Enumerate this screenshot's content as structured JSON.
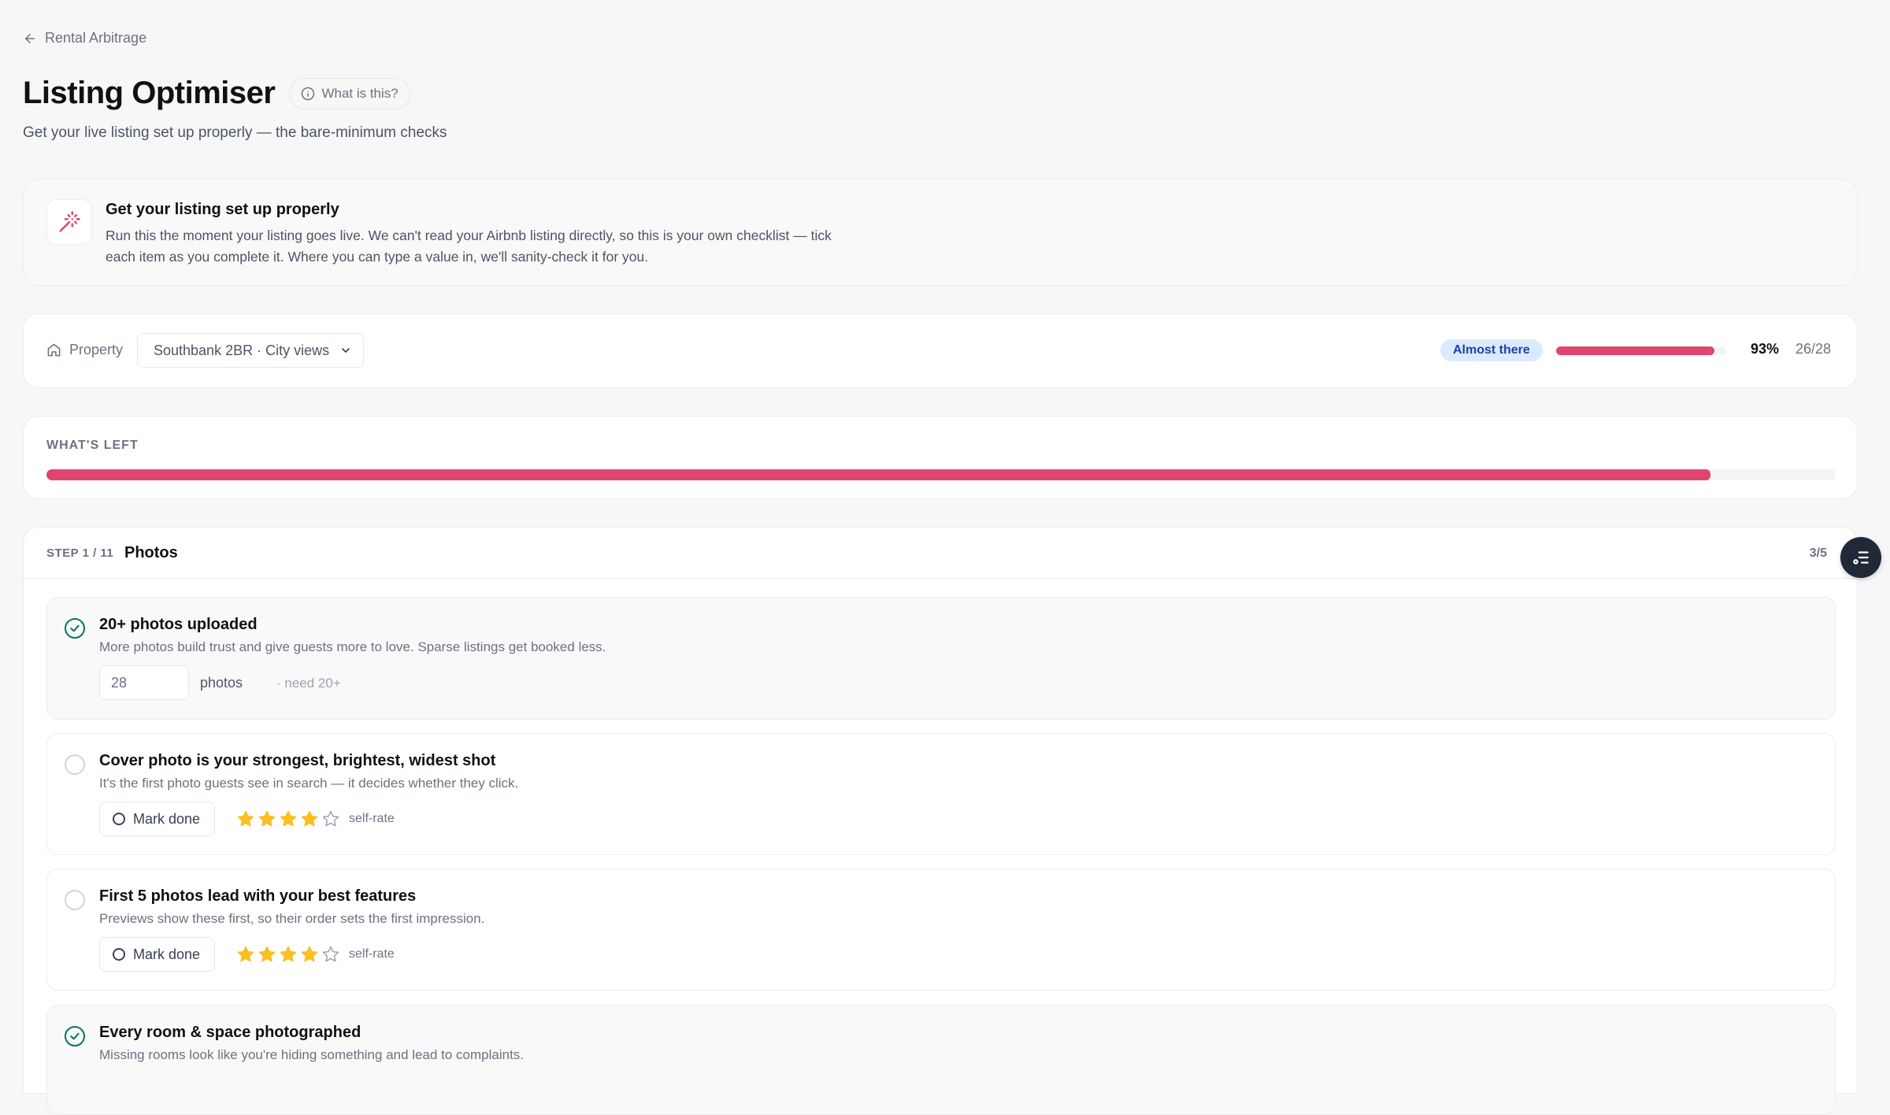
{
  "breadcrumb": {
    "label": "Rental Arbitrage"
  },
  "header": {
    "title": "Listing Optimiser",
    "help_label": "What is this?",
    "subtitle": "Get your live listing set up properly — the bare-minimum checks"
  },
  "intro": {
    "title": "Get your listing set up properly",
    "text": "Run this the moment your listing goes live. We can't read your Airbnb listing directly, so this is your own checklist — tick each item as you complete it. Where you can type a value in, we'll sanity-check it for you."
  },
  "property": {
    "label": "Property",
    "selected": "Southbank 2BR · City views",
    "status_badge": "Almost there",
    "progress_pct": 93,
    "percent_label": "93%",
    "count_label": "26/28"
  },
  "whats_left": {
    "label": "WHAT'S LEFT",
    "progress_pct": 93
  },
  "step": {
    "label": "STEP 1 / 11",
    "name": "Photos",
    "count": "3/5",
    "items": [
      {
        "title": "20+ photos uploaded",
        "desc": "More photos build trust and give guests more to love. Sparse listings get booked less.",
        "done": true,
        "input_value": "28",
        "unit": "photos",
        "need": "· need 20+"
      },
      {
        "title": "Cover photo is your strongest, brightest, widest shot",
        "desc": "It's the first photo guests see in search — it decides whether they click.",
        "done": false,
        "button_label": "Mark done",
        "rating": 4,
        "rating_max": 5,
        "rating_label": "self-rate"
      },
      {
        "title": "First 5 photos lead with your best features",
        "desc": "Previews show these first, so their order sets the first impression.",
        "done": false,
        "button_label": "Mark done",
        "rating": 4,
        "rating_max": 5,
        "rating_label": "self-rate"
      },
      {
        "title": "Every room & space photographed",
        "desc": "Missing rooms look like you're hiding something and lead to complaints.",
        "done": true
      }
    ]
  },
  "colors": {
    "accent": "#e0466d",
    "done_green": "#047857",
    "star": "#fbbf24",
    "badge_bg": "#dbeafe",
    "badge_text": "#1e40af"
  },
  "icons": {
    "back": "arrow-left-icon",
    "help": "info-icon",
    "intro": "magic-wand-icon",
    "property": "home-icon",
    "select": "chevron-down-icon",
    "fab": "checklist-icon"
  }
}
